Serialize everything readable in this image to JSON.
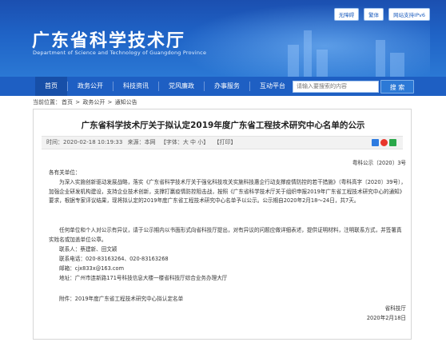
{
  "header": {
    "title_cn": "广东省科学技术厅",
    "title_en": "Department of Science and Technology of Guangdong Province",
    "top_links": [
      "无障碍",
      "繁体",
      "网站支持IPv6"
    ]
  },
  "nav": {
    "items": [
      "首页",
      "政务公开",
      "科技资讯",
      "党风廉政",
      "办事服务",
      "互动平台"
    ]
  },
  "search": {
    "placeholder": "请输入要搜索的内容",
    "button": "搜 索"
  },
  "breadcrumb": {
    "label": "当前位置：",
    "path": [
      "首页",
      "政务公开",
      "通知公告"
    ]
  },
  "article": {
    "title": "广东省科学技术厅关于拟认定2019年度广东省工程技术研究中心名单的公示",
    "meta": {
      "time": "时间：2020-02-18 10:19:33",
      "source": "来源：本网",
      "font_size": "【字体：大  中  小】",
      "print": "【打印】"
    },
    "doc_no": "粤科公示〔2020〕3号",
    "salutation": "各有关单位：",
    "para1": "为深入实施创新驱动发展战略，落实《广东省科学技术厅关于强化科技攻关实施科技惠企行动支撑疫情防控的若干措施》（粤科高字〔2020〕39号），加强企业研发机构建设，支持企业技术创新，支撑打赢疫情防控阻击战，按照《广东省科学技术厅关于组织申报2019年广东省工程技术研究中心的通知》要求，根据专家评议结果，现将拟认定的2019年度广东省工程技术研究中心名单予以公示。公示期自2020年2月18～24日，共7天。",
    "para2": "任何单位和个人对公示有异议，请于公示期内以书面形式向省科技厅提出，对有异议的问题应做详细表述，提供证明材料，注明联系方式，并签署真实姓名或加盖单位公章。",
    "contacts": {
      "people": "联系人：蔡建新、田文颖",
      "phone": "联系电话：020-83163264、020-83163268",
      "email": "邮箱：cjx833x@163.com",
      "address": "地址：广州市连新路171号科技信息大楼一楼省科技厅综合业务办理大厅"
    },
    "attachment": "附件：2019年度广东省工程技术研究中心拟认定名单",
    "issuer": "省科技厅",
    "date": "2020年2月18日"
  }
}
